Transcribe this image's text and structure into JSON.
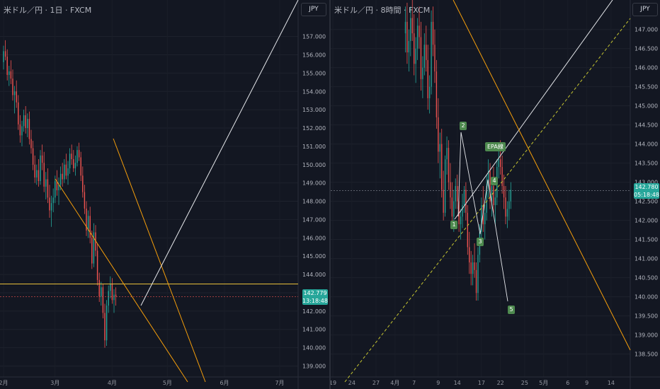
{
  "chart_data": [
    {
      "type": "candlestick",
      "title": "米ドル／円 · 1日 · FXCM",
      "currency": "JPY",
      "ylim": [
        138.4,
        158.3
      ],
      "y_ticks": [
        "139.000",
        "140.000",
        "141.000",
        "142.000",
        "143.000",
        "144.000",
        "145.000",
        "146.000",
        "147.000",
        "148.000",
        "149.000",
        "150.000",
        "151.000",
        "152.000",
        "153.000",
        "154.000",
        "155.000",
        "156.000",
        "157.000"
      ],
      "x_ticks": [
        {
          "label": "2月",
          "x": 0
        },
        {
          "label": "3月",
          "x": 28
        },
        {
          "label": "4月",
          "x": 59
        },
        {
          "label": "5月",
          "x": 89
        },
        {
          "label": "6月",
          "x": 120
        },
        {
          "label": "7月",
          "x": 150
        }
      ],
      "last_price": "142.779",
      "countdown": "13:18:48",
      "horizontal_line": 143.48,
      "candles": [
        [
          0,
          155.6,
          156.5,
          155.2,
          156.2
        ],
        [
          1,
          156.2,
          156.8,
          155.7,
          155.9
        ],
        [
          2,
          155.9,
          156.3,
          154.6,
          154.9
        ],
        [
          3,
          154.9,
          155.4,
          154.3,
          155.1
        ],
        [
          4,
          155.1,
          155.7,
          154.4,
          154.7
        ],
        [
          5,
          154.7,
          155.2,
          153.5,
          153.8
        ],
        [
          6,
          153.8,
          154.3,
          152.8,
          154.0
        ],
        [
          7,
          154.0,
          154.6,
          153.1,
          153.4
        ],
        [
          8,
          153.4,
          153.8,
          151.9,
          152.2
        ],
        [
          9,
          152.2,
          152.7,
          151.2,
          151.6
        ],
        [
          10,
          151.6,
          152.4,
          151.0,
          152.1
        ],
        [
          11,
          152.1,
          153.0,
          151.8,
          152.7
        ],
        [
          12,
          152.7,
          153.2,
          151.7,
          152.0
        ],
        [
          13,
          152.0,
          152.8,
          151.5,
          152.5
        ],
        [
          14,
          152.5,
          152.9,
          151.1,
          151.4
        ],
        [
          15,
          151.4,
          151.9,
          150.6,
          150.9
        ],
        [
          16,
          150.9,
          151.3,
          149.7,
          150.0
        ],
        [
          17,
          150.0,
          150.5,
          149.0,
          149.3
        ],
        [
          18,
          149.3,
          150.0,
          148.9,
          149.7
        ],
        [
          19,
          149.7,
          150.3,
          148.8,
          149.1
        ],
        [
          20,
          149.1,
          150.8,
          148.9,
          150.5
        ],
        [
          21,
          150.5,
          151.1,
          149.7,
          150.1
        ],
        [
          22,
          150.1,
          150.7,
          148.5,
          148.8
        ],
        [
          23,
          148.8,
          149.6,
          148.1,
          149.2
        ],
        [
          24,
          149.2,
          149.8,
          147.9,
          148.2
        ],
        [
          25,
          148.2,
          148.9,
          147.1,
          147.5
        ],
        [
          26,
          147.5,
          148.3,
          146.6,
          147.9
        ],
        [
          27,
          147.9,
          148.7,
          147.4,
          148.2
        ],
        [
          28,
          148.2,
          149.4,
          147.9,
          149.1
        ],
        [
          29,
          149.1,
          149.7,
          148.3,
          148.6
        ],
        [
          30,
          148.6,
          149.3,
          147.8,
          148.9
        ],
        [
          31,
          148.9,
          149.9,
          148.6,
          149.5
        ],
        [
          32,
          149.5,
          150.1,
          148.8,
          149.2
        ],
        [
          33,
          149.2,
          150.3,
          149.0,
          150.0
        ],
        [
          34,
          150.0,
          150.6,
          149.2,
          149.4
        ],
        [
          35,
          149.4,
          150.2,
          148.9,
          149.8
        ],
        [
          36,
          149.8,
          150.9,
          149.5,
          150.6
        ],
        [
          37,
          150.6,
          151.1,
          150.0,
          150.3
        ],
        [
          38,
          150.3,
          150.8,
          149.6,
          149.8
        ],
        [
          39,
          149.8,
          150.5,
          149.4,
          150.1
        ],
        [
          40,
          150.1,
          151.0,
          149.9,
          150.8
        ],
        [
          41,
          150.8,
          151.2,
          150.2,
          150.4
        ],
        [
          42,
          150.4,
          150.7,
          149.1,
          149.4
        ],
        [
          43,
          149.4,
          149.9,
          148.2,
          148.5
        ],
        [
          44,
          148.5,
          148.9,
          147.3,
          147.6
        ],
        [
          45,
          147.6,
          148.0,
          146.1,
          146.4
        ],
        [
          46,
          146.4,
          147.5,
          146.0,
          147.2
        ],
        [
          47,
          147.2,
          147.7,
          145.7,
          146.0
        ],
        [
          48,
          146.0,
          146.4,
          144.3,
          144.6
        ],
        [
          49,
          144.6,
          146.8,
          144.4,
          146.3
        ],
        [
          50,
          146.3,
          146.7,
          145.0,
          145.3
        ],
        [
          51,
          145.3,
          145.7,
          143.4,
          143.7
        ],
        [
          52,
          143.7,
          144.1,
          142.5,
          142.8
        ],
        [
          53,
          142.8,
          143.6,
          142.3,
          143.3
        ],
        [
          54,
          143.3,
          143.5,
          141.6,
          141.9
        ],
        [
          55,
          141.9,
          142.4,
          140.0,
          140.4
        ],
        [
          56,
          140.4,
          142.6,
          140.1,
          142.3
        ],
        [
          57,
          142.3,
          143.4,
          141.9,
          143.1
        ],
        [
          58,
          143.1,
          143.9,
          142.7,
          143.5
        ],
        [
          59,
          143.5,
          143.8,
          142.4,
          142.6
        ],
        [
          60,
          142.6,
          143.2,
          141.9,
          142.9
        ],
        [
          61,
          142.9,
          143.3,
          142.3,
          142.8
        ]
      ]
    },
    {
      "type": "candlestick",
      "title": "米ドル／円 · 8時間 · FXCM",
      "currency": "JPY",
      "ylim": [
        137.9,
        147.55
      ],
      "y_ticks": [
        "138.500",
        "139.000",
        "139.500",
        "140.000",
        "140.500",
        "141.000",
        "141.500",
        "142.000",
        "142.500",
        "143.000",
        "143.500",
        "144.000",
        "144.500",
        "145.000",
        "145.500",
        "146.000",
        "146.500",
        "147.000"
      ],
      "x_ticks": [
        {
          "label": "19",
          "x": 0
        },
        {
          "label": "24",
          "x": 11
        },
        {
          "label": "27",
          "x": 25
        },
        {
          "label": "4月",
          "x": 36
        },
        {
          "label": "7",
          "x": 47
        },
        {
          "label": "9",
          "x": 61
        },
        {
          "label": "14",
          "x": 72
        },
        {
          "label": "17",
          "x": 86
        },
        {
          "label": "22",
          "x": 97
        },
        {
          "label": "25",
          "x": 111
        },
        {
          "label": "5月",
          "x": 122
        },
        {
          "label": "6",
          "x": 136
        },
        {
          "label": "9",
          "x": 147
        },
        {
          "label": "14",
          "x": 161
        }
      ],
      "last_price": "142.780",
      "countdown": "05:18:48",
      "current_price_line": 142.78,
      "wave_labels": [
        "1",
        "2",
        "3",
        "4",
        "5"
      ],
      "epa_label": "EPA線",
      "candles": [
        [
          42,
          146.9,
          147.6,
          146.4,
          147.2
        ],
        [
          43,
          147.2,
          147.7,
          146.1,
          146.4
        ],
        [
          44,
          146.4,
          147.0,
          145.9,
          146.7
        ],
        [
          45,
          146.7,
          147.6,
          146.3,
          147.3
        ],
        [
          46,
          147.3,
          147.8,
          146.7,
          146.9
        ],
        [
          47,
          146.9,
          147.4,
          145.8,
          146.1
        ],
        [
          48,
          146.1,
          146.8,
          145.6,
          146.5
        ],
        [
          49,
          146.5,
          147.3,
          146.2,
          147.1
        ],
        [
          50,
          147.1,
          147.6,
          146.5,
          146.8
        ],
        [
          51,
          146.8,
          147.2,
          145.4,
          145.7
        ],
        [
          52,
          145.7,
          146.3,
          145.2,
          146.0
        ],
        [
          53,
          146.0,
          146.9,
          145.8,
          146.6
        ],
        [
          54,
          146.6,
          147.1,
          145.9,
          146.2
        ],
        [
          55,
          146.2,
          146.6,
          144.9,
          145.2
        ],
        [
          56,
          145.2,
          145.8,
          144.8,
          145.5
        ],
        [
          57,
          145.5,
          147.5,
          145.3,
          147.2
        ],
        [
          58,
          147.2,
          147.6,
          146.3,
          146.6
        ],
        [
          59,
          146.6,
          147.0,
          145.6,
          145.9
        ],
        [
          60,
          145.9,
          146.2,
          144.4,
          144.7
        ],
        [
          61,
          144.7,
          145.2,
          143.5,
          143.8
        ],
        [
          62,
          143.8,
          144.3,
          143.1,
          144.0
        ],
        [
          63,
          144.0,
          144.4,
          142.6,
          142.8
        ],
        [
          64,
          142.8,
          143.3,
          142.0,
          142.2
        ],
        [
          65,
          142.2,
          143.7,
          142.1,
          143.6
        ],
        [
          66,
          143.6,
          144.2,
          143.2,
          143.9
        ],
        [
          67,
          143.9,
          144.1,
          142.8,
          143.0
        ],
        [
          68,
          143.0,
          143.5,
          142.3,
          142.6
        ],
        [
          69,
          142.6,
          143.0,
          141.9,
          142.1
        ],
        [
          70,
          142.1,
          142.8,
          141.7,
          142.5
        ],
        [
          71,
          142.5,
          143.1,
          142.3,
          142.9
        ],
        [
          72,
          142.9,
          143.2,
          142.3,
          142.5
        ],
        [
          73,
          142.5,
          142.9,
          141.7,
          141.9
        ],
        [
          74,
          141.9,
          142.3,
          141.5,
          142.1
        ],
        [
          75,
          142.1,
          142.7,
          141.8,
          142.4
        ],
        [
          76,
          142.4,
          142.9,
          142.2,
          142.8
        ],
        [
          77,
          142.8,
          143.0,
          142.0,
          142.2
        ],
        [
          78,
          142.2,
          142.4,
          141.1,
          141.3
        ],
        [
          79,
          141.3,
          141.7,
          140.6,
          140.9
        ],
        [
          80,
          140.9,
          141.2,
          140.3,
          140.6
        ],
        [
          81,
          140.6,
          141.1,
          140.3,
          140.9
        ],
        [
          82,
          140.9,
          141.4,
          140.5,
          140.7
        ],
        [
          83,
          140.7,
          140.9,
          139.9,
          140.1
        ],
        [
          84,
          140.1,
          141.3,
          139.9,
          141.1
        ],
        [
          85,
          141.1,
          141.9,
          140.9,
          141.7
        ],
        [
          86,
          141.7,
          142.6,
          141.5,
          142.4
        ],
        [
          87,
          142.4,
          142.9,
          141.7,
          141.9
        ],
        [
          88,
          141.9,
          142.4,
          141.5,
          142.2
        ],
        [
          89,
          142.2,
          143.2,
          142.0,
          142.9
        ],
        [
          90,
          142.9,
          143.6,
          142.6,
          143.3
        ],
        [
          91,
          143.3,
          143.5,
          142.3,
          142.5
        ],
        [
          92,
          142.5,
          143.1,
          142.1,
          142.9
        ],
        [
          93,
          142.9,
          143.4,
          142.2,
          142.4
        ],
        [
          94,
          142.4,
          142.8,
          141.9,
          142.6
        ],
        [
          95,
          142.6,
          143.6,
          142.4,
          143.4
        ],
        [
          96,
          143.4,
          143.9,
          143.1,
          143.6
        ],
        [
          97,
          143.6,
          144.1,
          143.2,
          143.4
        ],
        [
          98,
          143.4,
          143.7,
          142.7,
          142.9
        ],
        [
          99,
          142.9,
          143.2,
          142.3,
          142.6
        ],
        [
          100,
          142.6,
          142.9,
          141.9,
          142.1
        ],
        [
          101,
          142.1,
          142.5,
          141.8,
          142.3
        ],
        [
          102,
          142.3,
          142.8,
          142.0,
          142.5
        ],
        [
          103,
          142.5,
          143.0,
          142.3,
          142.8
        ]
      ]
    }
  ]
}
